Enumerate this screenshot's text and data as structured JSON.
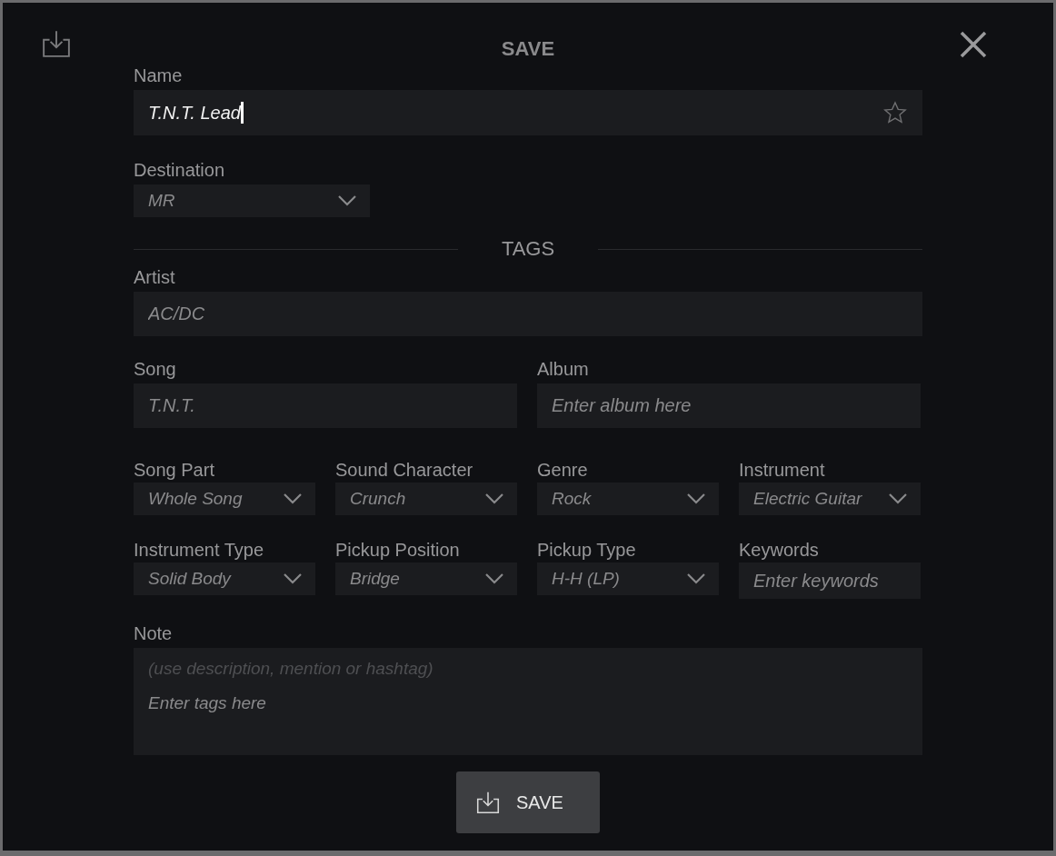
{
  "dialog": {
    "title": "SAVE"
  },
  "name": {
    "label": "Name",
    "value": "T.N.T. Lead",
    "favorite": false
  },
  "destination": {
    "label": "Destination",
    "value": "MR"
  },
  "tags_heading": "TAGS",
  "artist": {
    "label": "Artist",
    "value": "AC/DC"
  },
  "song": {
    "label": "Song",
    "value": "T.N.T."
  },
  "album": {
    "label": "Album",
    "placeholder": "Enter album here"
  },
  "tag_fields": [
    {
      "kind": "select",
      "label": "Song Part",
      "value": "Whole Song"
    },
    {
      "kind": "select",
      "label": "Sound Character",
      "value": "Crunch"
    },
    {
      "kind": "select",
      "label": "Genre",
      "value": "Rock"
    },
    {
      "kind": "select",
      "label": "Instrument",
      "value": "Electric Guitar"
    },
    {
      "kind": "select",
      "label": "Instrument Type",
      "value": "Solid Body"
    },
    {
      "kind": "select",
      "label": "Pickup Position",
      "value": "Bridge"
    },
    {
      "kind": "select",
      "label": "Pickup Type",
      "value": "H-H (LP)"
    },
    {
      "kind": "input",
      "label": "Keywords",
      "placeholder": "Enter keywords"
    }
  ],
  "note": {
    "label": "Note",
    "hint": "(use description, mention or hashtag)",
    "placeholder": "Enter tags here"
  },
  "save_button": {
    "label": "SAVE"
  }
}
